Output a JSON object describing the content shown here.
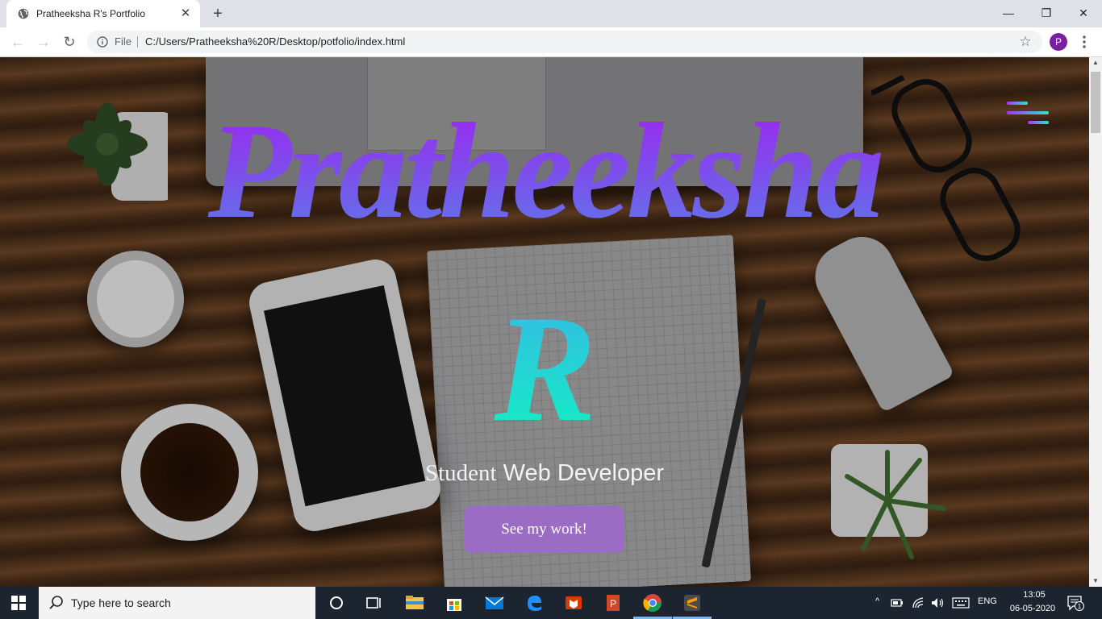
{
  "browser": {
    "tab_title": "Pratheeksha R's Portfolio",
    "tab_close": "✕",
    "new_tab": "+",
    "window_controls": {
      "minimize": "—",
      "maximize": "❐",
      "close": "✕"
    },
    "nav": {
      "back": "←",
      "forward": "→",
      "reload": "↻"
    },
    "address": {
      "scheme_label": "File",
      "url": "C:/Users/Pratheeksha%20R/Desktop/potfolio/index.html"
    },
    "bookmark_icon": "☆",
    "profile_initial": "P"
  },
  "hero": {
    "name": "Pratheeksha",
    "initial": "R",
    "subtitle_part1": "Student",
    "subtitle_part2": "Web Developer",
    "cta_label": "See my work!",
    "name_gradient": [
      "#a020f0",
      "#5b7be8"
    ],
    "initial_gradient": [
      "#38b6e8",
      "#11f2c0"
    ],
    "cta_color": "#9b6cc3"
  },
  "taskbar": {
    "search_placeholder": "Type here to search",
    "pinned": [
      "task-view-icon",
      "file-explorer-icon",
      "store-icon",
      "mail-icon",
      "edge-icon",
      "office-icon",
      "powerpoint-icon",
      "chrome-icon",
      "sublime-text-icon"
    ],
    "tray": {
      "language": "ENG",
      "time": "13:05",
      "date": "06-05-2020",
      "notification_count": "1"
    }
  }
}
